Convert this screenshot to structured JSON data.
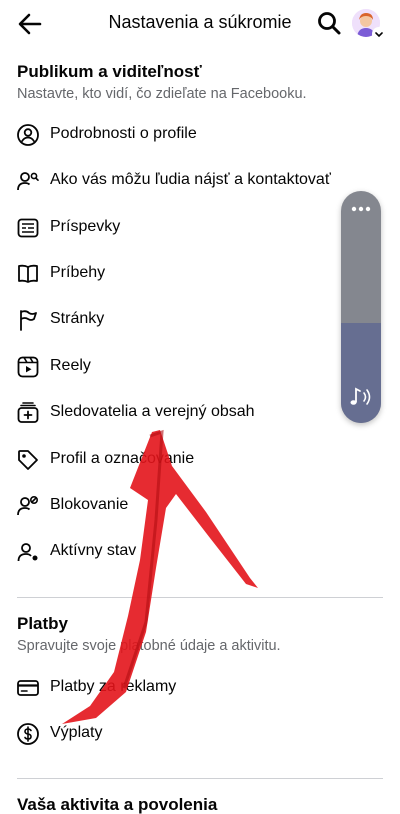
{
  "header": {
    "title": "Nastavenia a súkromie",
    "back_icon": "arrow-left-icon",
    "search_icon": "search-icon"
  },
  "audience": {
    "title": "Publikum a viditeľnosť",
    "description": "Nastavte, kto vidí, čo zdieľate na Facebooku.",
    "items": [
      {
        "label": "Podrobnosti o profile",
        "icon": "person-circle-icon"
      },
      {
        "label": "Ako vás môžu ľudia nájsť a kontaktovať",
        "icon": "person-search-icon"
      },
      {
        "label": "Príspevky",
        "icon": "posts-icon"
      },
      {
        "label": "Príbehy",
        "icon": "book-icon"
      },
      {
        "label": "Stránky",
        "icon": "flag-icon"
      },
      {
        "label": "Reely",
        "icon": "reels-icon"
      },
      {
        "label": "Sledovatelia a verejný obsah",
        "icon": "followers-icon"
      },
      {
        "label": "Profil a označovanie",
        "icon": "tag-icon"
      },
      {
        "label": "Blokovanie",
        "icon": "block-person-icon"
      },
      {
        "label": "Aktívny stav",
        "icon": "active-status-icon"
      }
    ]
  },
  "payments": {
    "title": "Platby",
    "description": "Spravujte svoje platobné údaje a aktivitu.",
    "items": [
      {
        "label": "Platby za reklamy",
        "icon": "credit-card-icon"
      },
      {
        "label": "Výplaty",
        "icon": "dollar-circle-icon"
      }
    ]
  },
  "activity": {
    "title": "Vaša aktivita a povolenia"
  },
  "volume_overlay": {
    "level": 0.43,
    "menu_icon": "more-dots-icon",
    "sound_icon": "music-note-icon"
  },
  "colors": {
    "text": "#050505",
    "secondary_text": "#65676b",
    "divider": "#ced0d4",
    "annotation_arrow": "#e3141b",
    "volume_track": "#84878f",
    "volume_fill": "#666e91"
  }
}
